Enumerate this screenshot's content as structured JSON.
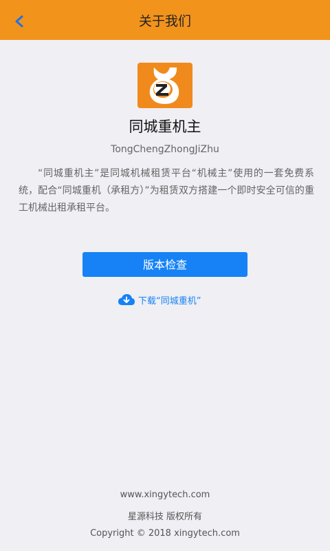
{
  "header": {
    "title": "关于我们",
    "back_icon": "chevron-left-icon"
  },
  "app": {
    "logo_icon": "app-logo-icon",
    "logo_letter": "Z",
    "name": "同城重机主",
    "pinyin": "TongChengZhongJiZhu",
    "description": "“同城重机主”是同城机械租赁平台“机械主”使用的一套免费系统，配合“同城重机（承租方）”为租赁双方搭建一个即时安全可信的重工机械出租承租平台。"
  },
  "actions": {
    "version_check_label": "版本检查",
    "download_label": "下载“同城重机”",
    "download_icon": "cloud-download-icon"
  },
  "footer": {
    "website": "www.xingytech.com",
    "rights": "星源科技 版权所有",
    "copyright": "Copyright © 2018 xingytech.com"
  },
  "colors": {
    "header_bg": "#f2931c",
    "accent_blue": "#1682f5",
    "page_bg": "#efeff4"
  }
}
